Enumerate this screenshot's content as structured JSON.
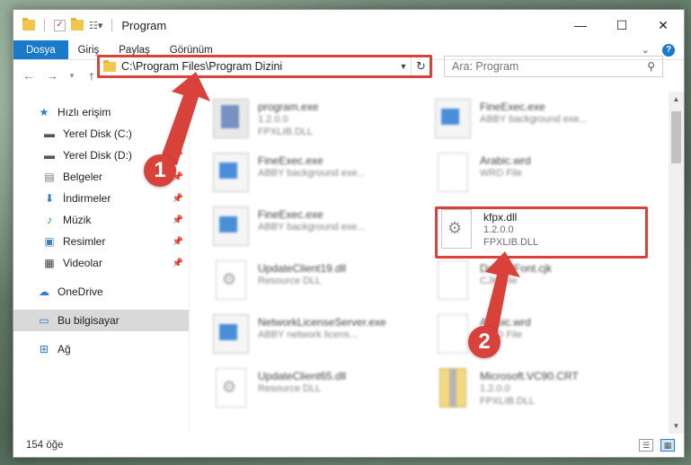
{
  "window": {
    "title": "Program",
    "controls": {
      "minimize": "—",
      "maximize": "☐",
      "close": "✕"
    }
  },
  "ribbon": {
    "tabs": [
      "Dosya",
      "Giriş",
      "Paylaş",
      "Görünüm"
    ],
    "expand_glyph": "⌄",
    "help": "?"
  },
  "address": {
    "path": "C:\\Program Files\\Program Dizini"
  },
  "search": {
    "placeholder": "Ara: Program"
  },
  "sidebar": {
    "quick_access": "Hızlı erişim",
    "pinned": [
      {
        "label": "Yerel Disk (C:)",
        "icon": "drive-icon"
      },
      {
        "label": "Yerel Disk (D:)",
        "icon": "drive-icon"
      },
      {
        "label": "Belgeler",
        "icon": "documents-icon"
      },
      {
        "label": "İndirmeler",
        "icon": "downloads-icon"
      },
      {
        "label": "Müzik",
        "icon": "music-icon"
      },
      {
        "label": "Resimler",
        "icon": "pictures-icon"
      },
      {
        "label": "Videolar",
        "icon": "videos-icon"
      }
    ],
    "onedrive": "OneDrive",
    "this_pc": "Bu bilgisayar",
    "network": "Ağ"
  },
  "files": [
    {
      "name": "program.exe",
      "line2": "1.2.0.0",
      "line3": "FPXLIB.DLL",
      "icon": "program-icon"
    },
    {
      "name": "FineExec.exe",
      "line2": "ABBY background exe...",
      "line3": "",
      "icon": "exe-icon"
    },
    {
      "name": "FineExec.exe",
      "line2": "ABBY background exe...",
      "line3": "",
      "icon": "exe-icon"
    },
    {
      "name": "Arabic.wrd",
      "line2": "WRD File",
      "line3": "",
      "icon": "document-icon"
    },
    {
      "name": "FineExec.exe",
      "line2": "ABBY background exe...",
      "line3": "",
      "icon": "exe-icon"
    },
    {
      "name": "kfpx.dll",
      "line2": "1.2.0.0",
      "line3": "FPXLIB.DLL",
      "icon": "gear-file-icon"
    },
    {
      "name": "UpdateClient19.dll",
      "line2": "Resource DLL",
      "line3": "",
      "icon": "gear-file-icon"
    },
    {
      "name": "DefaultFont.cjk",
      "line2": "CJK File",
      "line3": "",
      "icon": "document-icon"
    },
    {
      "name": "NetworkLicenseServer.exe",
      "line2": "ABBY network licens...",
      "line3": "",
      "icon": "exe-icon"
    },
    {
      "name": "Arabic.wrd",
      "line2": "WRD File",
      "line3": "",
      "icon": "document-icon"
    },
    {
      "name": "UpdateClient65.dll",
      "line2": "Resource DLL",
      "line3": "",
      "icon": "gear-file-icon"
    },
    {
      "name": "Microsoft.VC90.CRT",
      "line2": "1.2.0.0",
      "line3": "FPXLIB.DLL",
      "icon": "package-icon"
    }
  ],
  "status": {
    "item_count": "154 öğe"
  },
  "annotations": {
    "step1": "1",
    "step2": "2"
  },
  "colors": {
    "accent": "#1979ca",
    "highlight": "#d9413b"
  }
}
